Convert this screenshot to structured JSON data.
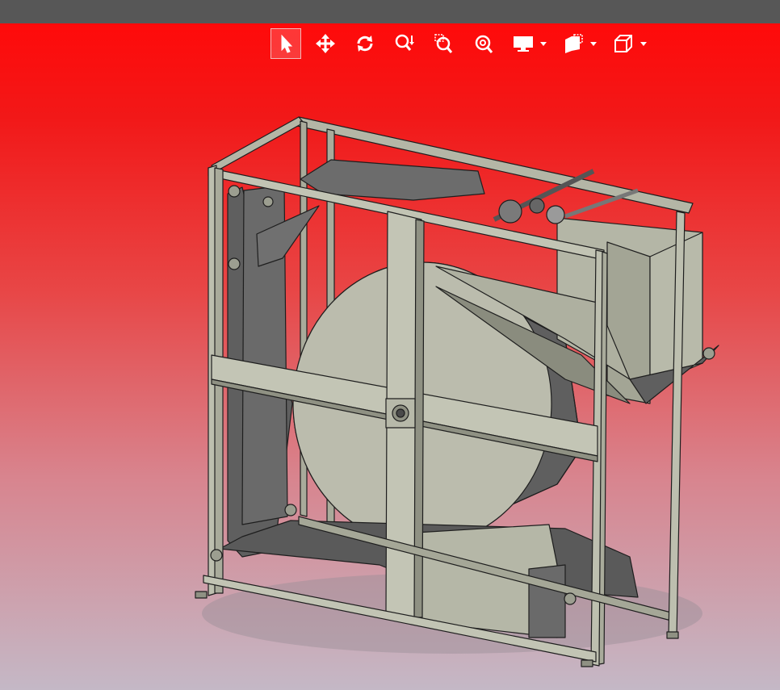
{
  "window": {
    "titlebar_color": "#575757"
  },
  "viewport": {
    "background_top": "#ff0a0a",
    "background_bottom": "#c4b8c6",
    "model_fill": "#b4b6a6",
    "model_shade": "#5e5e5e"
  },
  "toolbar": {
    "tools": [
      {
        "name": "select",
        "icon": "cursor-arrow-icon",
        "active": true
      },
      {
        "name": "pan",
        "icon": "pan-arrows-icon",
        "active": false
      },
      {
        "name": "rotate",
        "icon": "rotate-icon",
        "active": false
      },
      {
        "name": "zoom",
        "icon": "zoom-icon",
        "active": false
      },
      {
        "name": "zoom-window",
        "icon": "zoom-window-icon",
        "active": false
      },
      {
        "name": "zoom-fit",
        "icon": "zoom-fit-icon",
        "active": false
      },
      {
        "name": "display-mode",
        "icon": "monitor-icon",
        "dropdown": true
      },
      {
        "name": "section-view",
        "icon": "section-view-icon",
        "dropdown": true
      },
      {
        "name": "view-orientation",
        "icon": "cube-view-icon",
        "dropdown": true
      }
    ]
  }
}
